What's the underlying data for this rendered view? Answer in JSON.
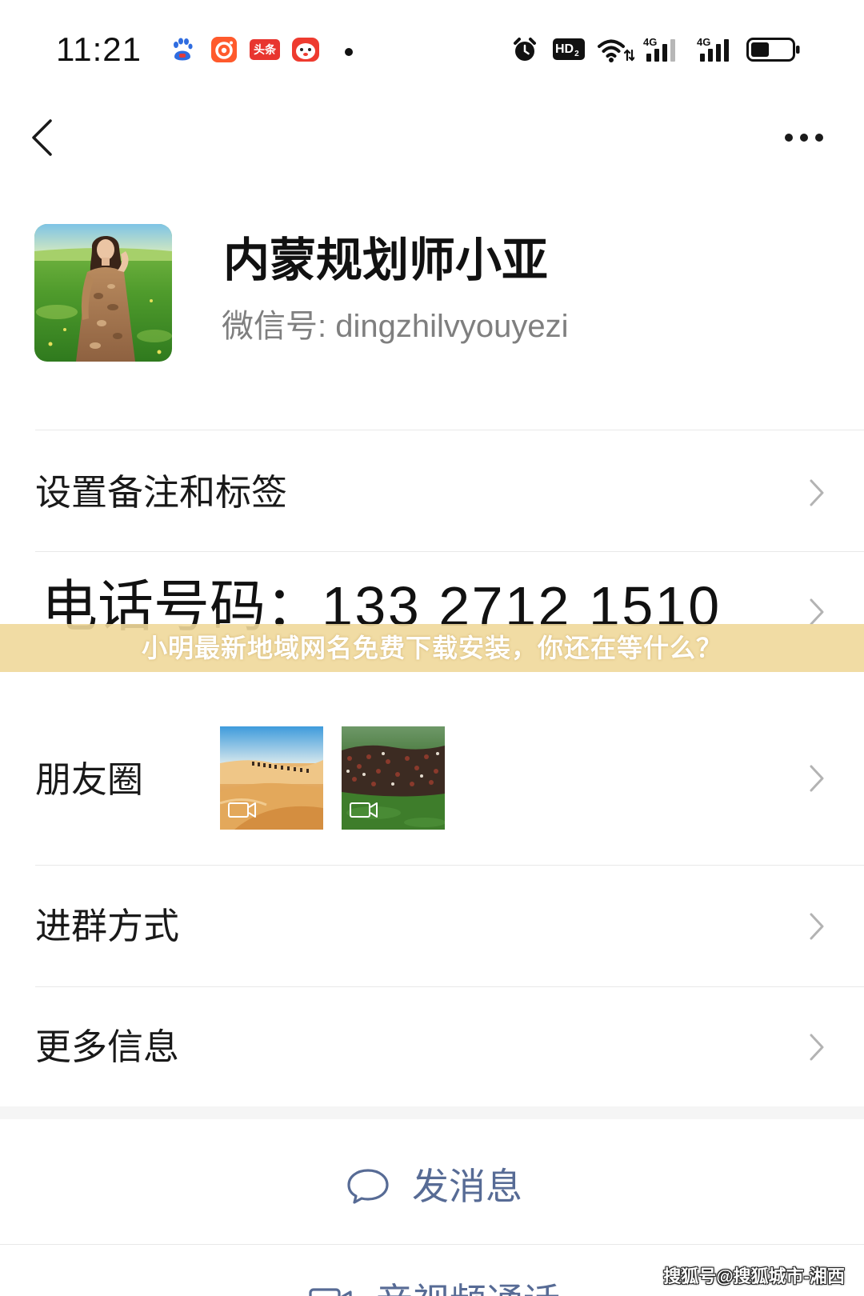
{
  "status_bar": {
    "time": "11:21",
    "left_icons": [
      "baidu-icon",
      "orange-app-icon",
      "toutiao-icon",
      "face-app-icon",
      "notification-dot-icon"
    ],
    "toutiao_label": "头条",
    "right_icons": [
      "alarm-icon",
      "hd-voice-icon",
      "wifi-icon",
      "signal-4g-icon",
      "signal-4g-icon",
      "battery-icon"
    ],
    "hd_label": "HD",
    "hd_sub": "2",
    "network_1": "4G",
    "network_2": "4G",
    "signal_1_bars": 3,
    "signal_2_bars": 4,
    "battery_level": 0.45
  },
  "header": {
    "back_icon": "back-arrow-icon",
    "more_icon": "more-icon"
  },
  "profile": {
    "name": "内蒙规划师小亚",
    "wechat_id": "微信号: dingzhilvyouyezi"
  },
  "rows": {
    "remark": {
      "label": "设置备注和标签"
    },
    "phone": {
      "label": "电话号码：",
      "value": "133 2712 1510"
    },
    "moments": {
      "label": "朋友圈",
      "thumbnails": [
        {
          "icon": "video-icon"
        },
        {
          "icon": "video-icon"
        }
      ]
    },
    "group": {
      "label": "进群方式"
    },
    "more": {
      "label": "更多信息"
    }
  },
  "banner": {
    "text": "小明最新地域网名免费下载安装，你还在等什么？"
  },
  "actions": {
    "message": {
      "label": "发消息",
      "icon": "chat-bubble-icon"
    },
    "call": {
      "label": "音视频通话",
      "icon": "video-call-icon"
    }
  },
  "watermark": "搜狐号@搜狐城市-湘西",
  "colors": {
    "accent": "#576B95",
    "text": "#191919",
    "secondary_text": "#7F7F7F",
    "divider": "#E8E8E8",
    "chevron": "#B3B3B3",
    "banner": "#EFD89A"
  }
}
